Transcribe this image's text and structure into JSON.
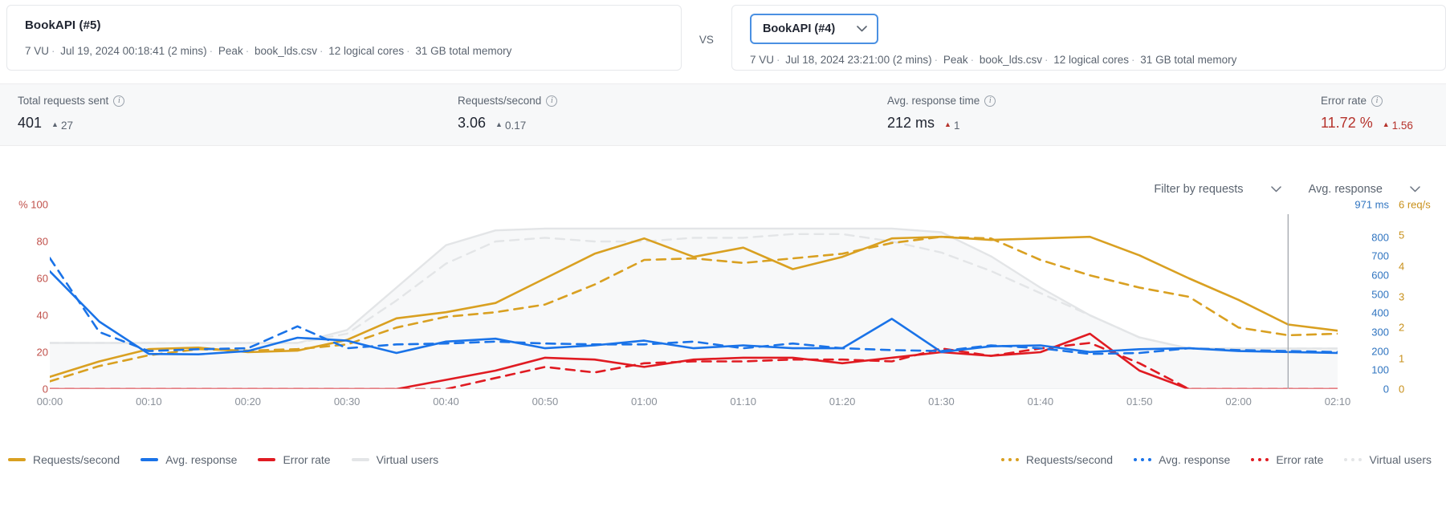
{
  "runs": {
    "left": {
      "title": "BookAPI (#5)",
      "meta": [
        "7 VU",
        "Jul 19, 2024 00:18:41 (2 mins)",
        "Peak",
        "book_lds.csv",
        "12 logical cores",
        "31 GB total memory"
      ]
    },
    "vs_label": "VS",
    "right": {
      "selected": "BookAPI (#4)",
      "chevron_icon": "chevron-down-icon",
      "meta": [
        "7 VU",
        "Jul 18, 2024 23:21:00 (2 mins)",
        "Peak",
        "book_lds.csv",
        "12 logical cores",
        "31 GB total memory"
      ]
    }
  },
  "stats": [
    {
      "label": "Total requests sent",
      "info_icon": "info-icon",
      "value": "401",
      "delta": "27",
      "delta_dir": "▲",
      "accent": "#1f2430"
    },
    {
      "label": "Requests/second",
      "info_icon": "info-icon",
      "value": "3.06",
      "delta": "0.17",
      "delta_dir": "▲",
      "accent": "#1f2430"
    },
    {
      "label": "Avg. response time",
      "info_icon": "info-icon",
      "value": "212 ms",
      "delta": "1",
      "delta_dir": "▲",
      "accent": "#1f2430"
    },
    {
      "label": "Error rate",
      "info_icon": "info-icon",
      "value": "11.72 %",
      "delta": "1.56",
      "delta_dir": "▲",
      "accent": "#b5322b"
    }
  ],
  "filters": [
    {
      "label": "Filter by requests",
      "chevron_icon": "chevron-down-icon"
    },
    {
      "label": "Avg. response",
      "chevron_icon": "chevron-down-icon"
    }
  ],
  "legend_primary": [
    {
      "label": "Requests/second",
      "color": "#d9a021",
      "style": "solid"
    },
    {
      "label": "Avg. response",
      "color": "#1a73e8",
      "style": "solid"
    },
    {
      "label": "Error rate",
      "color": "#e01b22",
      "style": "solid"
    },
    {
      "label": "Virtual users",
      "color": "#e3e5e7",
      "style": "solid"
    }
  ],
  "legend_comparison": [
    {
      "label": "Requests/second",
      "color": "#d9a021",
      "style": "dotted"
    },
    {
      "label": "Avg. response",
      "color": "#1a73e8",
      "style": "dotted"
    },
    {
      "label": "Error rate",
      "color": "#e01b22",
      "style": "dotted"
    },
    {
      "label": "Virtual users",
      "color": "#e3e5e7",
      "style": "dotted"
    }
  ],
  "chart_data": {
    "type": "line",
    "title": "",
    "xlabel": "",
    "grid": false,
    "legend_position": "bottom",
    "x_ticks": [
      "00:00",
      "00:10",
      "00:20",
      "00:30",
      "00:40",
      "00:50",
      "01:00",
      "01:10",
      "01:20",
      "01:30",
      "01:40",
      "01:50",
      "02:00",
      "02:10"
    ],
    "axes": {
      "left": {
        "name": "Error rate",
        "unit": "%",
        "unit_label": "%",
        "color": "#c0504a",
        "ticks": [
          100,
          80,
          60,
          40,
          20,
          0
        ],
        "range": [
          0,
          100
        ]
      },
      "right_ms": {
        "name": "Avg. response",
        "unit": "ms",
        "top_label": "971 ms",
        "color": "#2f74c0",
        "ticks": [
          971,
          800,
          700,
          600,
          500,
          400,
          300,
          200,
          100,
          0
        ],
        "range": [
          0,
          971
        ]
      },
      "right_rps": {
        "name": "Requests/second",
        "unit": "req/s",
        "top_label": "6 req/s",
        "color": "#c8901a",
        "ticks": [
          6,
          5,
          4,
          3,
          2,
          1,
          0
        ],
        "range": [
          0,
          6
        ]
      }
    },
    "cursor_line_time": "02:05",
    "series": [
      {
        "name": "Requests/second",
        "run": "BookAPI (#5)",
        "style": "solid",
        "color": "#d9a021",
        "axis": "right_rps",
        "unit": "req/s",
        "x": [
          0,
          5,
          10,
          15,
          20,
          25,
          30,
          35,
          40,
          45,
          50,
          55,
          60,
          65,
          70,
          75,
          80,
          85,
          90,
          95,
          100,
          105,
          110,
          115,
          120,
          125,
          130
        ],
        "values": [
          0.4,
          0.9,
          1.3,
          1.35,
          1.2,
          1.25,
          1.6,
          2.3,
          2.5,
          2.8,
          3.6,
          4.4,
          4.9,
          4.3,
          4.6,
          3.9,
          4.3,
          4.9,
          4.95,
          4.85,
          4.9,
          4.95,
          4.35,
          3.6,
          2.9,
          2.1,
          1.9
        ]
      },
      {
        "name": "Requests/second",
        "run": "BookAPI (#4)",
        "style": "dashed",
        "color": "#d9a021",
        "axis": "right_rps",
        "unit": "req/s",
        "x": [
          0,
          5,
          10,
          15,
          20,
          25,
          30,
          35,
          40,
          45,
          50,
          55,
          60,
          65,
          70,
          75,
          80,
          85,
          90,
          95,
          100,
          105,
          110,
          115,
          120,
          125,
          130
        ],
        "values": [
          0.25,
          0.75,
          1.1,
          1.3,
          1.25,
          1.3,
          1.45,
          2.0,
          2.35,
          2.5,
          2.75,
          3.4,
          4.2,
          4.25,
          4.1,
          4.25,
          4.4,
          4.75,
          4.95,
          4.9,
          4.2,
          3.7,
          3.3,
          3.0,
          2.0,
          1.75,
          1.8
        ]
      },
      {
        "name": "Avg. response",
        "run": "BookAPI (#5)",
        "style": "solid",
        "color": "#1a73e8",
        "axis": "right_ms",
        "unit": "ms",
        "x": [
          0,
          5,
          10,
          15,
          20,
          25,
          30,
          35,
          40,
          45,
          50,
          55,
          60,
          65,
          70,
          75,
          80,
          85,
          90,
          95,
          100,
          105,
          110,
          115,
          120,
          125,
          130
        ],
        "values": [
          620,
          355,
          185,
          183,
          200,
          270,
          255,
          190,
          250,
          265,
          215,
          230,
          255,
          215,
          230,
          215,
          215,
          370,
          195,
          225,
          230,
          195,
          210,
          215,
          200,
          195,
          190
        ]
      },
      {
        "name": "Avg. response",
        "run": "BookAPI (#4)",
        "style": "dashed",
        "color": "#1a73e8",
        "axis": "right_ms",
        "unit": "ms",
        "x": [
          0,
          5,
          10,
          15,
          20,
          25,
          30,
          35,
          40,
          45,
          50,
          55,
          60,
          65,
          70,
          75,
          80,
          85,
          90,
          95,
          100,
          105,
          110,
          115,
          120,
          125,
          130
        ],
        "values": [
          690,
          300,
          200,
          210,
          215,
          330,
          215,
          235,
          240,
          250,
          240,
          235,
          235,
          250,
          215,
          240,
          215,
          205,
          200,
          230,
          215,
          185,
          190,
          215,
          205,
          200,
          195
        ]
      },
      {
        "name": "Error rate",
        "run": "BookAPI (#5)",
        "style": "solid",
        "color": "#e01b22",
        "axis": "left",
        "unit": "%",
        "x": [
          0,
          5,
          10,
          15,
          20,
          25,
          30,
          35,
          40,
          45,
          50,
          55,
          60,
          65,
          70,
          75,
          80,
          85,
          90,
          95,
          100,
          105,
          110,
          115,
          120,
          125,
          130
        ],
        "values": [
          0,
          0,
          0,
          0,
          0,
          0,
          0,
          0,
          5,
          10,
          17,
          16,
          12,
          16,
          17,
          17,
          14,
          17,
          20,
          18,
          20,
          30,
          10,
          0,
          0,
          0,
          0
        ]
      },
      {
        "name": "Error rate",
        "run": "BookAPI (#4)",
        "style": "dashed",
        "color": "#e01b22",
        "axis": "left",
        "unit": "%",
        "x": [
          0,
          5,
          10,
          15,
          20,
          25,
          30,
          35,
          40,
          45,
          50,
          55,
          60,
          65,
          70,
          75,
          80,
          85,
          90,
          95,
          100,
          105,
          110,
          115,
          120,
          125,
          130
        ],
        "values": [
          0,
          0,
          0,
          0,
          0,
          0,
          0,
          0,
          0,
          6,
          12,
          9,
          14,
          15,
          15,
          16,
          16,
          15,
          22,
          18,
          22,
          25,
          14,
          0,
          0,
          0,
          0
        ]
      },
      {
        "name": "Virtual users",
        "run": "BookAPI (#5)",
        "style": "solid",
        "color": "#e3e5e7",
        "axis": "left",
        "unit": "VU",
        "x": [
          0,
          5,
          10,
          15,
          20,
          25,
          30,
          35,
          40,
          45,
          50,
          55,
          60,
          65,
          70,
          75,
          80,
          85,
          90,
          95,
          100,
          105,
          110,
          115,
          120,
          125,
          130
        ],
        "values": [
          25,
          25,
          25,
          25,
          25,
          25,
          32,
          55,
          78,
          86,
          87,
          87,
          87,
          87,
          87,
          87,
          87,
          87,
          85,
          72,
          55,
          40,
          28,
          22,
          22,
          22,
          22
        ]
      },
      {
        "name": "Virtual users",
        "run": "BookAPI (#4)",
        "style": "dashed",
        "color": "#e3e5e7",
        "axis": "left",
        "unit": "VU",
        "x": [
          0,
          5,
          10,
          15,
          20,
          25,
          30,
          35,
          40,
          45,
          50,
          55,
          60,
          65,
          70,
          75,
          80,
          85,
          90,
          95,
          100,
          105,
          110,
          115,
          120,
          125,
          130
        ],
        "values": [
          25,
          25,
          25,
          25,
          25,
          25,
          30,
          48,
          68,
          80,
          82,
          80,
          80,
          82,
          82,
          84,
          84,
          80,
          74,
          64,
          52,
          40,
          28,
          22,
          22,
          22,
          22
        ]
      }
    ]
  }
}
